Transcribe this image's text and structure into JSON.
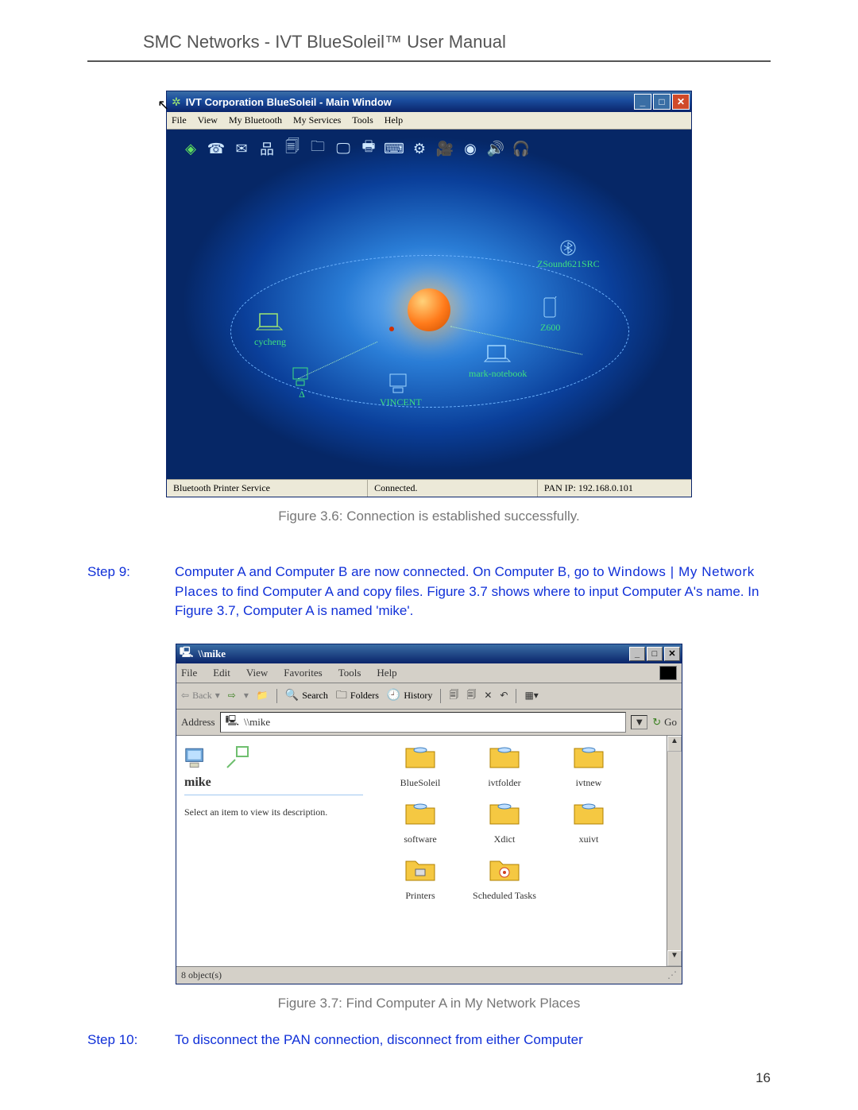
{
  "header": "SMC Networks - IVT BlueSoleil™ User Manual",
  "page_number": "16",
  "bluesoleil": {
    "title": "IVT Corporation BlueSoleil - Main Window",
    "menu": [
      "File",
      "View",
      "My Bluetooth",
      "My Services",
      "Tools",
      "Help"
    ],
    "devices": {
      "cycheng": "cycheng",
      "zsound": "ZSound621SRC",
      "z600": "Z600",
      "mark": "mark-notebook",
      "vincent": "VINCENT",
      "delta": "Δ"
    },
    "status": {
      "left": "Bluetooth Printer Service",
      "center": "Connected.",
      "right": "PAN IP: 192.168.0.101"
    }
  },
  "fig36": "Figure 3.6: Connection is established successfully.",
  "step9": {
    "label": "Step 9:",
    "text_part1": "Computer A and Computer B are now connected. On Computer B, go to ",
    "nav": "Windows | My Network Places",
    "text_part2": " to find Computer A and copy files. Figure 3.7 shows where to input Computer A's name. In Figure 3.7, Computer A is named 'mike'."
  },
  "explorer": {
    "title": "\\\\mike",
    "menu": [
      "File",
      "Edit",
      "View",
      "Favorites",
      "Tools",
      "Help"
    ],
    "back": "Back",
    "search": "Search",
    "folders": "Folders",
    "history": "History",
    "addr_label": "Address",
    "addr_value": "\\\\mike",
    "go": "Go",
    "left_name": "mike",
    "left_hint": "Select an item to view its description.",
    "items": [
      "BlueSoleil",
      "ivtfolder",
      "ivtnew",
      "software",
      "Xdict",
      "xuivt",
      "Printers",
      "Scheduled Tasks"
    ],
    "status": "8 object(s)"
  },
  "fig37": "Figure 3.7: Find Computer A in My Network Places",
  "step10": {
    "label": "Step 10:",
    "text": "To disconnect the PAN connection, disconnect from either Computer"
  }
}
